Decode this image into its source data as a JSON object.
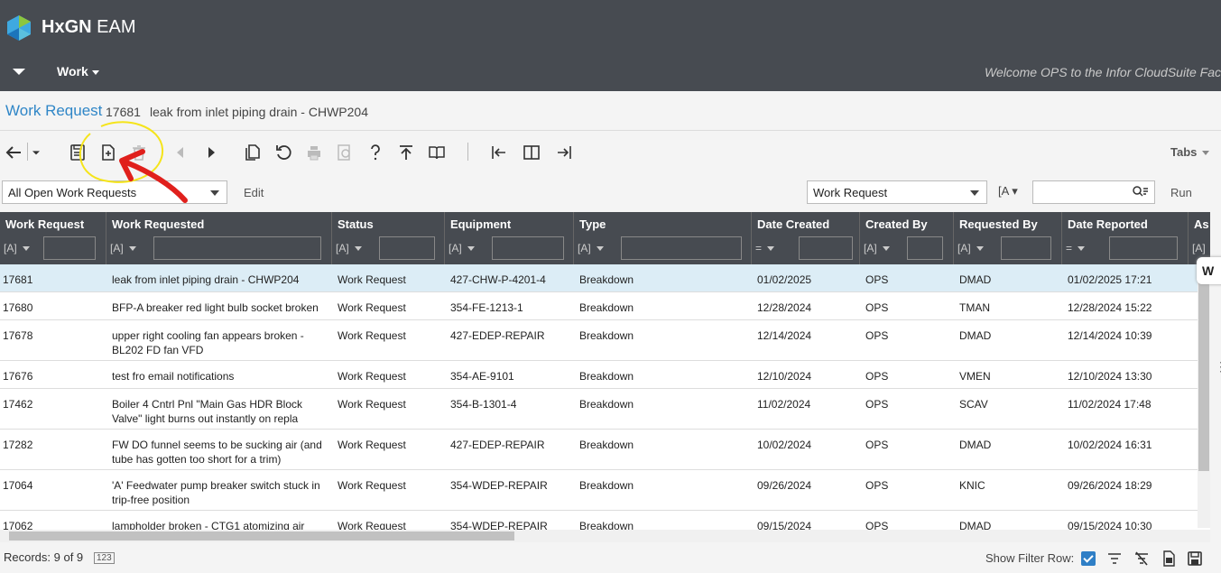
{
  "app": {
    "brand_bold": "HxGN",
    "brand_rest": " EAM"
  },
  "nav": {
    "work_menu": "Work",
    "welcome": "Welcome OPS to the Infor CloudSuite Facility"
  },
  "record": {
    "screen_title": "Work Request",
    "id": "17681",
    "description": "leak from inlet piping drain - CHWP204"
  },
  "toolbar": {
    "tabs_label": "Tabs"
  },
  "filters": {
    "dataspy": "All Open Work Requests",
    "edit_label": "Edit",
    "field_select": "Work Request",
    "operator": "[A",
    "run_label": "Run"
  },
  "grid": {
    "columns": [
      {
        "label": "Work Request",
        "op": "[A]"
      },
      {
        "label": "Work Requested",
        "op": "[A]"
      },
      {
        "label": "Status",
        "op": "[A]"
      },
      {
        "label": "Equipment",
        "op": "[A]"
      },
      {
        "label": "Type",
        "op": "[A]"
      },
      {
        "label": "Date Created",
        "op": "="
      },
      {
        "label": "Created By",
        "op": "[A]"
      },
      {
        "label": "Requested By",
        "op": "[A]"
      },
      {
        "label": "Date Reported",
        "op": "="
      },
      {
        "label": "As",
        "op": "[A]"
      }
    ],
    "rows": [
      {
        "wr": "17681",
        "desc": "leak from inlet piping drain - CHWP204",
        "status": "Work Request",
        "equip": "427-CHW-P-4201-4",
        "type": "Breakdown",
        "created": "01/02/2025",
        "by": "OPS",
        "req": "DMAD",
        "reported": "01/02/2025 17:21"
      },
      {
        "wr": "17680",
        "desc": "BFP-A breaker red light bulb socket broken",
        "status": "Work Request",
        "equip": "354-FE-1213-1",
        "type": "Breakdown",
        "created": "12/28/2024",
        "by": "OPS",
        "req": "TMAN",
        "reported": "12/28/2024 15:22"
      },
      {
        "wr": "17678",
        "desc": "upper right cooling fan appears broken - BL202 FD fan VFD",
        "status": "Work Request",
        "equip": "427-EDEP-REPAIR",
        "type": "Breakdown",
        "created": "12/14/2024",
        "by": "OPS",
        "req": "DMAD",
        "reported": "12/14/2024 10:39"
      },
      {
        "wr": "17676",
        "desc": "test fro email notifications",
        "status": "Work Request",
        "equip": "354-AE-9101",
        "type": "Breakdown",
        "created": "12/10/2024",
        "by": "OPS",
        "req": "VMEN",
        "reported": "12/10/2024 13:30"
      },
      {
        "wr": "17462",
        "desc": "Boiler 4 Cntrl Pnl \"Main Gas HDR Block Valve\" light burns out instantly on repla",
        "status": "Work Request",
        "equip": "354-B-1301-4",
        "type": "Breakdown",
        "created": "11/02/2024",
        "by": "OPS",
        "req": "SCAV",
        "reported": "11/02/2024 17:48"
      },
      {
        "wr": "17282",
        "desc": "FW DO funnel seems to be sucking air (and tube has gotten too short for a trim)",
        "status": "Work Request",
        "equip": "427-EDEP-REPAIR",
        "type": "Breakdown",
        "created": "10/02/2024",
        "by": "OPS",
        "req": "DMAD",
        "reported": "10/02/2024 16:31"
      },
      {
        "wr": "17064",
        "desc": "'A' Feedwater pump breaker switch stuck in trip-free position",
        "status": "Work Request",
        "equip": "354-WDEP-REPAIR",
        "type": "Breakdown",
        "created": "09/26/2024",
        "by": "OPS",
        "req": "KNIC",
        "reported": "09/26/2024 18:29"
      },
      {
        "wr": "17062",
        "desc": "lampholder broken - CTG1 atomizing air",
        "status": "Work Request",
        "equip": "354-WDEP-REPAIR",
        "type": "Breakdown",
        "created": "09/15/2024",
        "by": "OPS",
        "req": "DMAD",
        "reported": "09/15/2024 10:30"
      }
    ]
  },
  "footer": {
    "records": "Records: 9 of 9",
    "badge": "123",
    "show_filter_label": "Show Filter Row:"
  },
  "colors": {
    "header_bg": "#474b51",
    "accent": "#2f86c7",
    "selected_row": "#dcedf6",
    "annotation_circle": "#f5e41a",
    "annotation_arrow": "#e0201c"
  }
}
